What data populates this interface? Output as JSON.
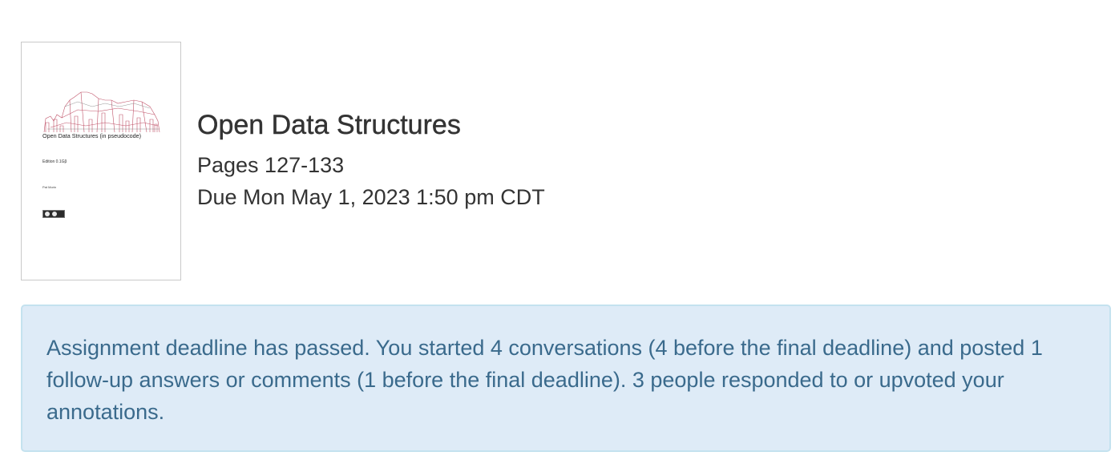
{
  "assignment": {
    "cover": {
      "title": "Open Data Structures (in pseudocode)",
      "edition": "Edition 0.1Gβ",
      "author": "Pat Morin"
    },
    "title": "Open Data Structures",
    "pages": "Pages 127-133",
    "due": "Due Mon May 1, 2023 1:50 pm CDT"
  },
  "alert": {
    "message": "Assignment deadline has passed. You started 4 conversations (4 before the final deadline) and posted 1 follow-up answers or comments (1 before the final deadline). 3 people responded to or upvoted your annotations."
  },
  "colors": {
    "alert_background": "#deebf7",
    "alert_border": "#c4e2ef",
    "alert_text": "#3a6a8c",
    "heading_text": "#333333",
    "cover_art": "#c0546a"
  }
}
